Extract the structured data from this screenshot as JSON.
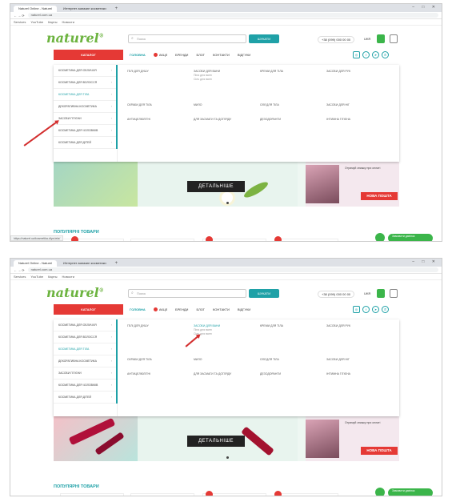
{
  "browser": {
    "tabs": [
      {
        "label": "Naturel Online - Naturel"
      },
      {
        "label": "Интернет-магазин косметики"
      }
    ],
    "new_tab": "+",
    "window_controls": "–  □  ✕",
    "nav_buttons": "←  →  ⟳",
    "url": "naturel.com.ua",
    "bookmarks": [
      "Services",
      "YouTube",
      "Карты",
      "Новости"
    ],
    "status_url": "https://naturel.ua/kosmetika-dlya-tela/"
  },
  "site": {
    "logo": "naturel",
    "logo_mark": "®",
    "search_placeholder": "Поиск",
    "search_button": "ШУКАТИ",
    "phone": "+38 (099) 000 00 00",
    "lang": "UKR",
    "catalog_button": "КАТАЛОГ",
    "menu": {
      "home": "ГОЛОВНА",
      "promo": "АКЦІЇ",
      "brands": "БРЕНДИ",
      "blog": "БЛОГ",
      "contacts": "КОНТАКТИ",
      "reviews": "ВІДГУКИ"
    },
    "social_icons": [
      "instagram-icon",
      "facebook-icon",
      "telegram-icon",
      "viber-icon"
    ]
  },
  "mega_menu": {
    "sidebar": [
      "КОСМЕТИКА ДЛЯ ОБЛИЧЧЯ",
      "КОСМЕТИКА ДЛЯ ВОЛОССЯ",
      "КОСМЕТИКА ДЛЯ ТІЛА",
      "ДЕКОРАТИВНА КОСМЕТИКА",
      "ЗАСОБИ ГІГІЄНИ",
      "КОСМЕТИКА ДЛЯ ЧОЛОВІКІВ",
      "КОСМЕТИКА ДЛЯ ДІТЕЙ"
    ],
    "sidebar_chevron": "›",
    "columns": [
      {
        "title": "ГЕЛІ ДЛЯ ДУШУ",
        "subs": []
      },
      {
        "title": "ЗАСОБИ ДЛЯ ВАНИ",
        "subs": [
          "Піна для ванн",
          "Сіль для ванн"
        ]
      },
      {
        "title": "КРЕМИ ДЛЯ ТІЛА",
        "subs": []
      },
      {
        "title": "ЗАСОБИ ДЛЯ РУК",
        "subs": []
      },
      {
        "title": "СКРАБИ ДЛЯ ТІЛА",
        "subs": []
      },
      {
        "title": "МИЛО",
        "subs": []
      },
      {
        "title": "ОЛІЇ ДЛЯ ТІЛА",
        "subs": []
      },
      {
        "title": "ЗАСОБИ ДЛЯ НІГ",
        "subs": []
      },
      {
        "title": "АНТИЦЕЛЮЛІТНІ",
        "subs": []
      },
      {
        "title": "ДЛЯ ЗАСМАГИ ТА ДОГЛЯДУ",
        "subs": []
      },
      {
        "title": "ДЕЗОДОРАНТИ",
        "subs": []
      },
      {
        "title": "ІНТИМНА ГІГІЄНА",
        "subs": []
      }
    ]
  },
  "banner": {
    "button": "ДЕТАЛЬНІШЕ",
    "right_text": "Отримуй знижку при оплаті",
    "right_badge": "НОВА ПОШТА"
  },
  "popular_title": "ПОПУЛЯРНІ ТОВАРИ",
  "callback_text": "Замовити дзвінок"
}
